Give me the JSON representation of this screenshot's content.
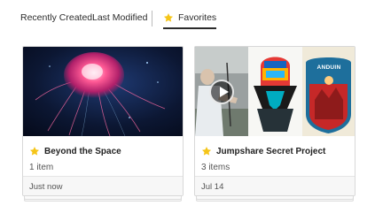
{
  "tabs": {
    "recent": "Recently Created",
    "modified": "Last Modified",
    "favorites": "Favorites",
    "active": "favorites"
  },
  "colors": {
    "star": "#f5c518",
    "text": "#2b2b2b",
    "jellyfish_bg": "#0d1530",
    "jellyfish_glow": "#ff4f8b"
  },
  "icons": {
    "favorite_star": "star-icon",
    "play": "play-icon"
  },
  "cards": [
    {
      "title": "Beyond the Space",
      "count": "1 item",
      "date": "Just now",
      "starred": true
    },
    {
      "title": "Jumpshare Secret Project",
      "count": "3 items",
      "date": "Jul 14",
      "starred": true,
      "artwork_text": "ANDUIN"
    }
  ]
}
